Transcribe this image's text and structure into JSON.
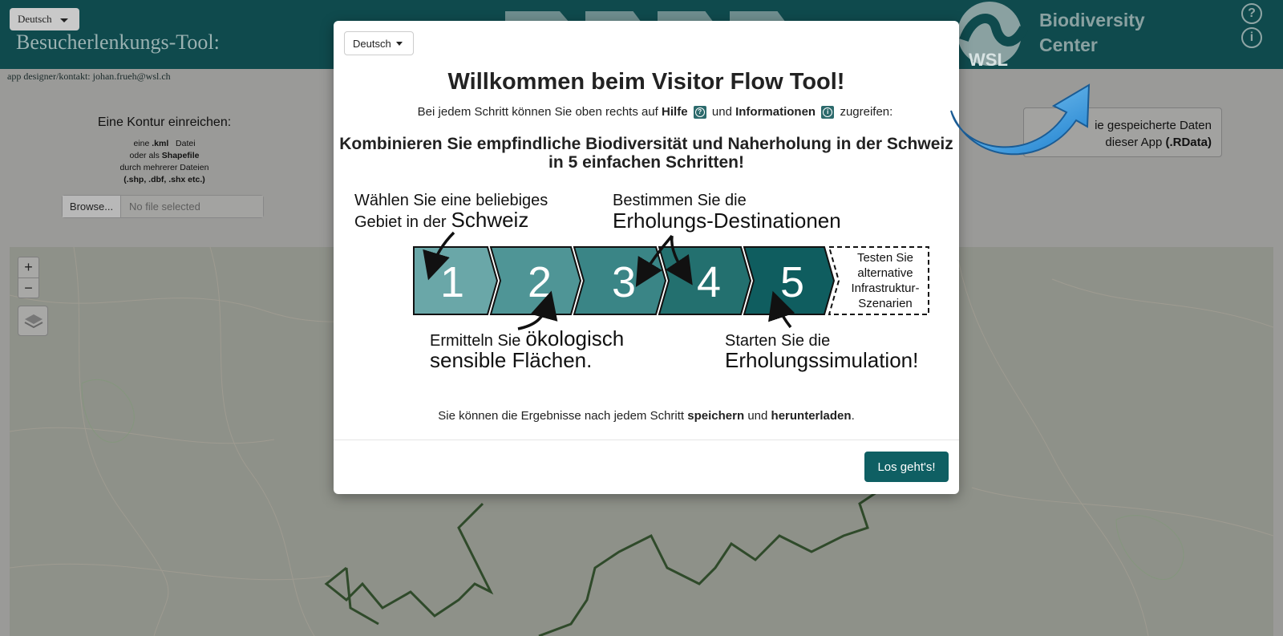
{
  "header": {
    "language_button": "Deutsch",
    "app_title": "Besucherlenkungs-Tool:",
    "logo_text": "WSL",
    "brand_line1": "Biodiversity",
    "brand_line2": "Center",
    "help_icon_glyph": "?",
    "info_icon_glyph": "i"
  },
  "designer_text": "app designer/kontakt: johan.frueh@wsl.ch",
  "upload": {
    "title": "Eine Kontur einreichen:",
    "line1_a": "eine",
    "line1_b": ".kml",
    "line1_c": "Datei",
    "line2_a": "oder als",
    "line2_b": "Shapefile",
    "line3": "durch mehrerer Dateien",
    "line4": "(.shp, .dbf, .shx etc.)",
    "browse_label": "Browse...",
    "file_placeholder": "No file selected"
  },
  "rdata_box": {
    "line1": "ie gespeicherte Daten",
    "line2_a": "dieser App",
    "line2_b": "(.RData)"
  },
  "map": {
    "zoom_in": "+",
    "zoom_out": "−"
  },
  "modal": {
    "language_button": "Deutsch",
    "title": "Willkommen beim Visitor Flow Tool!",
    "help_a": "Bei jedem Schritt können Sie oben rechts auf",
    "help_b": "Hilfe",
    "help_c": "und",
    "help_d": "Informationen",
    "help_e": "zugreifen:",
    "help_icon_glyph": "?",
    "info_icon_glyph": "i",
    "combine_line1": "Kombinieren Sie empfindliche Biodiversität und Naherholung in der Schweiz",
    "combine_line2_a": "in",
    "combine_line2_b": "5 einfachen Schritten",
    "combine_line2_c": "!",
    "step1_a": "Wählen Sie eine beliebiges",
    "step1_b": "Gebiet in der",
    "step1_c": "Schweiz",
    "step2_a": "Ermitteln Sie",
    "step2_b": "ökologisch",
    "step2_c": "sensible Flächen.",
    "step3_a": "Bestimmen Sie die",
    "step3_b": "Erholungs-Destinationen",
    "step5_a": "Starten Sie die",
    "step5_b": "Erholungssimulation!",
    "num1": "1",
    "num2": "2",
    "num3": "3",
    "num4": "4",
    "num5": "5",
    "alt_line1": "Testen Sie",
    "alt_line2": "alternative",
    "alt_line3": "Infrastruktur-",
    "alt_line4": "Szenarien",
    "save_a": "Sie können die Ergebnisse nach jedem Schritt",
    "save_b": "speichern",
    "save_c": "und",
    "save_d": "herunterladen",
    "save_e": ".",
    "go_button": "Los geht's!"
  },
  "colors": {
    "header_bg": "#0f4a4d",
    "step1": "#6aa7a8",
    "step2": "#4f9596",
    "step3": "#3a8586",
    "step4": "#23706f",
    "step5": "#0f5d5f",
    "button": "#0f5f63",
    "arrow_blue": "#3fa6e6"
  }
}
